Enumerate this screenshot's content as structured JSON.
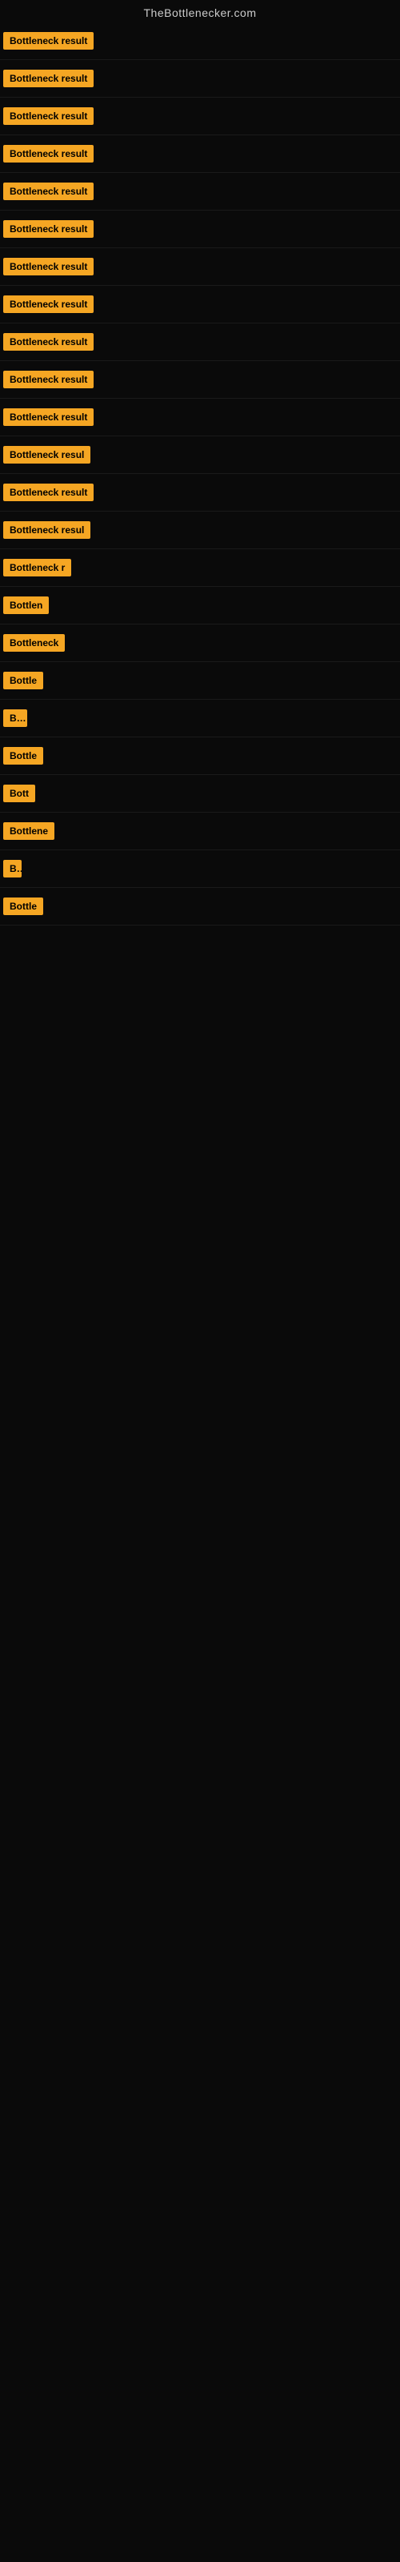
{
  "site": {
    "title": "TheBottlenecker.com"
  },
  "rows": [
    {
      "label": "Bottleneck result",
      "truncated": false
    },
    {
      "label": "Bottleneck result",
      "truncated": false
    },
    {
      "label": "Bottleneck result",
      "truncated": false
    },
    {
      "label": "Bottleneck result",
      "truncated": false
    },
    {
      "label": "Bottleneck result",
      "truncated": false
    },
    {
      "label": "Bottleneck result",
      "truncated": false
    },
    {
      "label": "Bottleneck result",
      "truncated": false
    },
    {
      "label": "Bottleneck result",
      "truncated": false
    },
    {
      "label": "Bottleneck result",
      "truncated": false
    },
    {
      "label": "Bottleneck result",
      "truncated": false
    },
    {
      "label": "Bottleneck result",
      "truncated": false
    },
    {
      "label": "Bottleneck resul",
      "truncated": true
    },
    {
      "label": "Bottleneck result",
      "truncated": false
    },
    {
      "label": "Bottleneck resul",
      "truncated": true
    },
    {
      "label": "Bottleneck r",
      "truncated": true
    },
    {
      "label": "Bottlen",
      "truncated": true
    },
    {
      "label": "Bottleneck",
      "truncated": true
    },
    {
      "label": "Bottle",
      "truncated": true
    },
    {
      "label": "Bo",
      "truncated": true
    },
    {
      "label": "Bottle",
      "truncated": true
    },
    {
      "label": "Bott",
      "truncated": true
    },
    {
      "label": "Bottlene",
      "truncated": true
    },
    {
      "label": "B",
      "truncated": true
    },
    {
      "label": "Bottle",
      "truncated": true
    }
  ],
  "accent_color": "#f5a623"
}
